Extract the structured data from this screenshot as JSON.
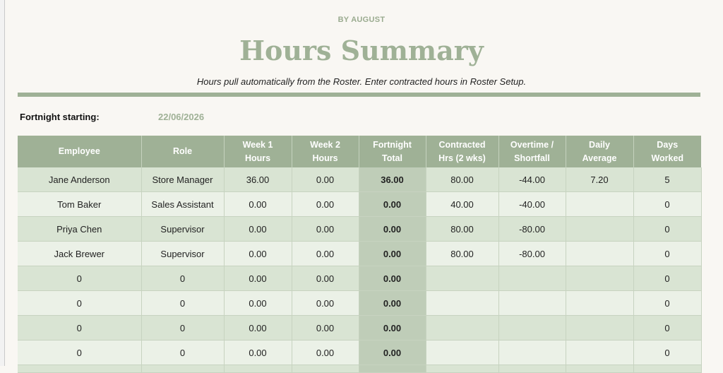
{
  "brand": "BY AUGUST",
  "title": "Hours Summary",
  "subtitle": "Hours pull automatically from the Roster. Enter contracted hours in Roster Setup.",
  "fortnight": {
    "label": "Fortnight starting:",
    "value": "22/06/2026"
  },
  "table": {
    "headers": {
      "employee": "Employee",
      "role": "Role",
      "week1_a": "Week 1",
      "week1_b": "Hours",
      "week2_a": "Week 2",
      "week2_b": "Hours",
      "total_a": "Fortnight",
      "total_b": "Total",
      "contracted_a": "Contracted",
      "contracted_b": "Hrs (2 wks)",
      "overtime_a": "Overtime /",
      "overtime_b": "Shortfall",
      "daily_a": "Daily",
      "daily_b": "Average",
      "days_a": "Days",
      "days_b": "Worked"
    },
    "rows": [
      {
        "employee": "Jane Anderson",
        "role": "Store Manager",
        "week1": "36.00",
        "week2": "0.00",
        "total": "36.00",
        "contracted": "80.00",
        "overtime": "-44.00",
        "daily": "7.20",
        "days": "5"
      },
      {
        "employee": "Tom Baker",
        "role": "Sales Assistant",
        "week1": "0.00",
        "week2": "0.00",
        "total": "0.00",
        "contracted": "40.00",
        "overtime": "-40.00",
        "daily": "",
        "days": "0"
      },
      {
        "employee": "Priya Chen",
        "role": "Supervisor",
        "week1": "0.00",
        "week2": "0.00",
        "total": "0.00",
        "contracted": "80.00",
        "overtime": "-80.00",
        "daily": "",
        "days": "0"
      },
      {
        "employee": "Jack Brewer",
        "role": "Supervisor",
        "week1": "0.00",
        "week2": "0.00",
        "total": "0.00",
        "contracted": "80.00",
        "overtime": "-80.00",
        "daily": "",
        "days": "0"
      },
      {
        "employee": "0",
        "role": "0",
        "week1": "0.00",
        "week2": "0.00",
        "total": "0.00",
        "contracted": "",
        "overtime": "",
        "daily": "",
        "days": "0"
      },
      {
        "employee": "0",
        "role": "0",
        "week1": "0.00",
        "week2": "0.00",
        "total": "0.00",
        "contracted": "",
        "overtime": "",
        "daily": "",
        "days": "0"
      },
      {
        "employee": "0",
        "role": "0",
        "week1": "0.00",
        "week2": "0.00",
        "total": "0.00",
        "contracted": "",
        "overtime": "",
        "daily": "",
        "days": "0"
      },
      {
        "employee": "0",
        "role": "0",
        "week1": "0.00",
        "week2": "0.00",
        "total": "0.00",
        "contracted": "",
        "overtime": "",
        "daily": "",
        "days": "0"
      }
    ]
  },
  "colors": {
    "accent": "#9fb196",
    "row_odd": "#d9e4d3",
    "row_even": "#ebf1e7",
    "total_col": "#bfcdb8"
  }
}
